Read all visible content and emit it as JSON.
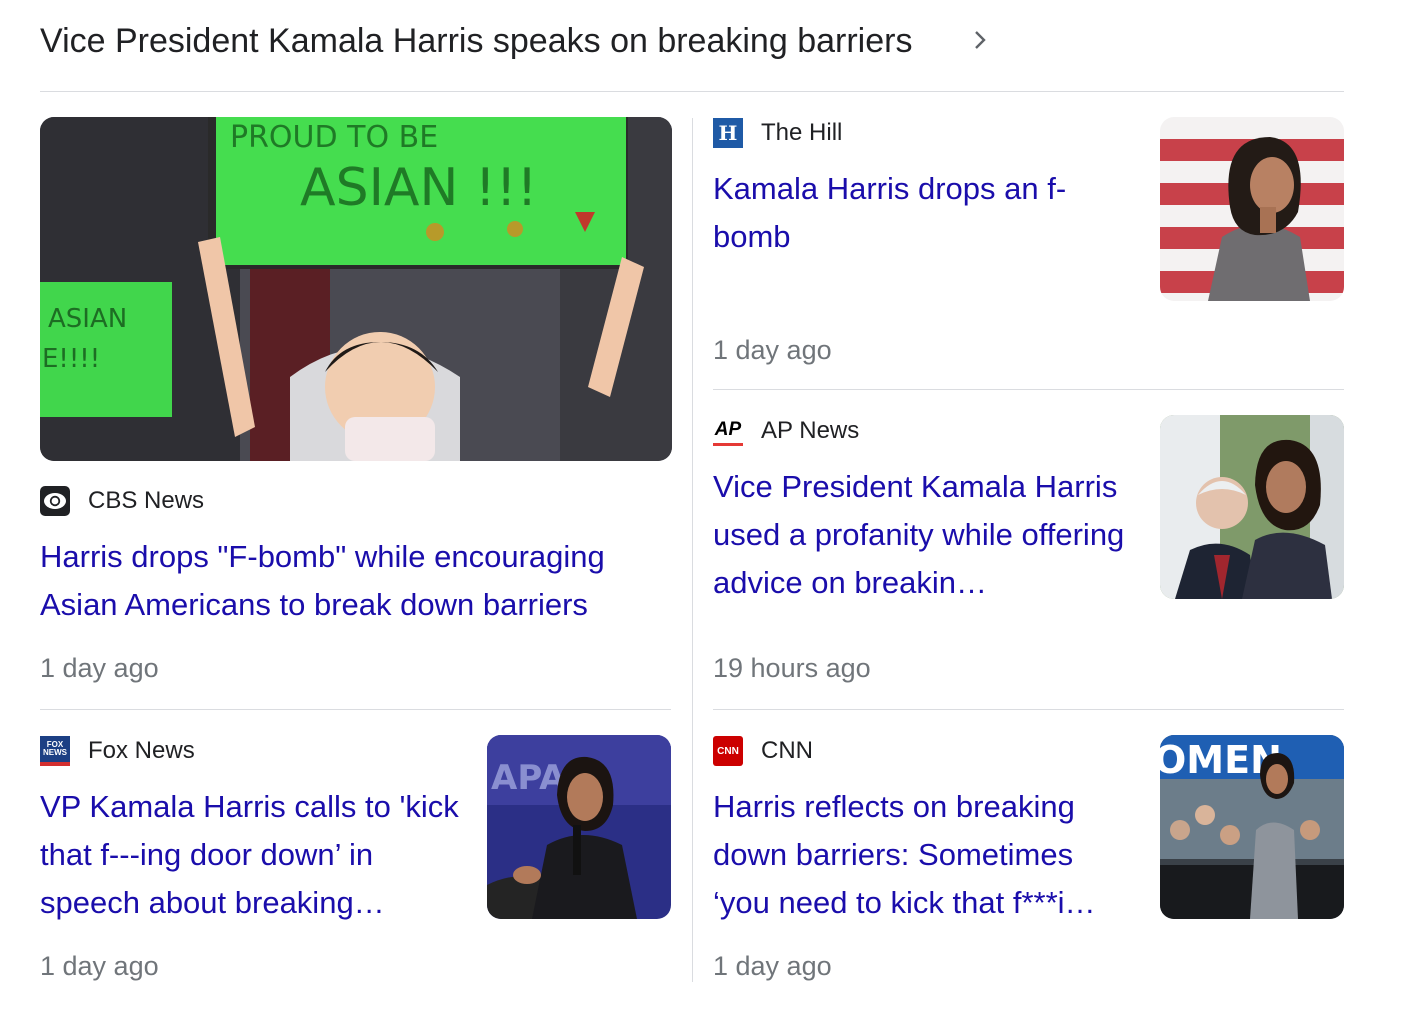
{
  "header": {
    "title": "Vice President Kamala Harris speaks on breaking barriers",
    "chevron_icon": "chevron-right-icon"
  },
  "colors": {
    "link": "#1a0dab",
    "meta": "#70757a",
    "divider": "#dadce0"
  },
  "stories": [
    {
      "source": "CBS News",
      "source_icon": "cbs-eye-logo",
      "headline": "Harris drops \"F-bomb\" while encouraging Asian Americans to break down barriers",
      "time": "1 day ago",
      "image": {
        "sign_main_line1": "PROUD TO BE",
        "sign_main_line2": "ASIAN !!!",
        "sign_left_line1": "ASIAN",
        "sign_left_line2": "E!!!!"
      }
    },
    {
      "source": "The Hill",
      "source_icon": "the-hill-logo",
      "logo_text": "H",
      "headline": "Kamala Harris drops an f-bomb",
      "time": "1 day ago"
    },
    {
      "source": "AP News",
      "source_icon": "ap-logo",
      "logo_text": "AP",
      "headline": "Vice President Kamala Harris used a profanity while offering advice on breakin…",
      "time": "19 hours ago"
    },
    {
      "source": "Fox News",
      "source_icon": "fox-news-logo",
      "logo_text": "FOX NEWS",
      "headline": "VP Kamala Harris calls to 'kick that f---ing door down’ in speech about breaking…",
      "time": "1 day ago",
      "image": {
        "backdrop_text": "APA"
      }
    },
    {
      "source": "CNN",
      "source_icon": "cnn-logo",
      "logo_text": "CNN",
      "headline": "Harris reflects on breaking down barriers: Sometimes ‘you need to kick that f***i…",
      "time": "1 day ago",
      "image": {
        "banner_text": "OMEN"
      }
    }
  ]
}
